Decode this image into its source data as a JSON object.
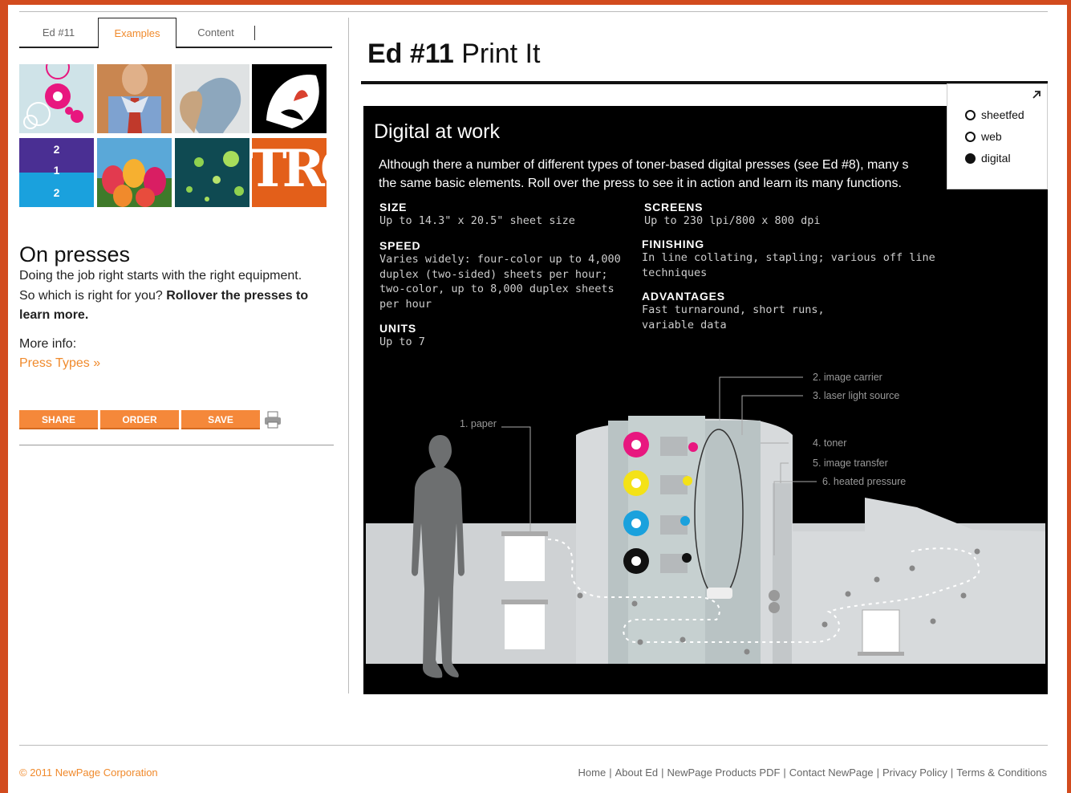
{
  "tabs": [
    {
      "label": "Ed #11"
    },
    {
      "label": "Examples"
    },
    {
      "label": "Content"
    }
  ],
  "sidebar": {
    "title": "On presses",
    "body_plain": "Doing the job right starts with the right equipment. So which is right for you? ",
    "body_bold": "Rollover the presses to learn more.",
    "more_info_label": "More info:",
    "press_types_link": "Press Types »",
    "actions": {
      "share": "SHARE",
      "order": "ORDER",
      "save": "SAVE"
    }
  },
  "thumbs": {
    "booklet_numbers": [
      "2",
      "1",
      "2"
    ],
    "tro_text": "TRO"
  },
  "main": {
    "title_bold": "Ed #11",
    "title_rest": " Print It",
    "stage_title": "Digital at work",
    "intro_line1": "Although there a number of different types of toner-based digital presses (see Ed #8), many s",
    "intro_line2": "the same basic elements. Roll over the press to see it in action and learn its many functions.",
    "specs": {
      "size": {
        "label": "SIZE",
        "value": "Up to 14.3\" x 20.5\" sheet size"
      },
      "speed": {
        "label": "SPEED",
        "value_lines": [
          "Varies widely: four-color up to 4,000",
          "duplex (two-sided) sheets per hour;",
          "two-color, up to 8,000 duplex sheets",
          "per hour"
        ]
      },
      "units": {
        "label": "UNITS",
        "value": "Up to 7"
      },
      "screens": {
        "label": "SCREENS",
        "value": "Up to 230 lpi/800 x 800 dpi"
      },
      "finishing": {
        "label": "FINISHING",
        "value_lines": [
          "In line collating, stapling; various off line",
          "techniques"
        ]
      },
      "advantages": {
        "label": "ADVANTAGES",
        "value_lines": [
          "Fast turnaround, short runs,",
          "variable data"
        ]
      }
    },
    "diagram_labels": {
      "paper": "1. paper",
      "image_carrier": "2. image carrier",
      "laser": "3. laser light source",
      "toner": "4. toner",
      "image_transfer": "5. image transfer",
      "heated_pressure": "6. heated pressure"
    },
    "press_options": [
      {
        "label": "sheetfed",
        "selected": false
      },
      {
        "label": "web",
        "selected": false
      },
      {
        "label": "digital",
        "selected": true
      }
    ],
    "toner_colors": [
      "#e8177f",
      "#f4e217",
      "#1aa1dd",
      "#111111"
    ]
  },
  "footer": {
    "copyright": "© 2011 NewPage Corporation",
    "links": [
      "Home",
      "About Ed",
      "NewPage Products PDF",
      "Contact NewPage",
      "Privacy Policy",
      "Terms & Conditions"
    ]
  },
  "colors": {
    "accent": "#f08a2c",
    "frame": "#d24b1e"
  }
}
